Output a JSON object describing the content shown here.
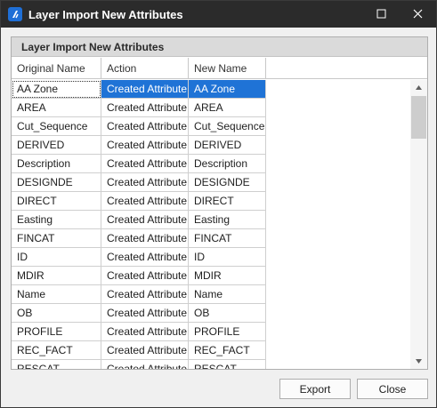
{
  "window": {
    "title": "Layer Import New Attributes",
    "icons": {
      "app": "app-logo-icon",
      "maximize": "maximize-icon",
      "close": "close-icon"
    }
  },
  "panel": {
    "title": "Layer Import New Attributes"
  },
  "grid": {
    "columns": [
      "Original Name",
      "Action",
      "New Name"
    ],
    "rows": [
      {
        "original": "AA Zone",
        "action": "Created Attribute",
        "new_name": "AA Zone"
      },
      {
        "original": "AREA",
        "action": "Created Attribute",
        "new_name": "AREA"
      },
      {
        "original": "Cut_Sequence",
        "action": "Created Attribute",
        "new_name": "Cut_Sequence"
      },
      {
        "original": "DERIVED",
        "action": "Created Attribute",
        "new_name": "DERIVED"
      },
      {
        "original": "Description",
        "action": "Created Attribute",
        "new_name": "Description"
      },
      {
        "original": "DESIGNDE",
        "action": "Created Attribute",
        "new_name": "DESIGNDE"
      },
      {
        "original": "DIRECT",
        "action": "Created Attribute",
        "new_name": "DIRECT"
      },
      {
        "original": "Easting",
        "action": "Created Attribute",
        "new_name": "Easting"
      },
      {
        "original": "FINCAT",
        "action": "Created Attribute",
        "new_name": "FINCAT"
      },
      {
        "original": "ID",
        "action": "Created Attribute",
        "new_name": "ID"
      },
      {
        "original": "MDIR",
        "action": "Created Attribute",
        "new_name": "MDIR"
      },
      {
        "original": "Name",
        "action": "Created Attribute",
        "new_name": "Name"
      },
      {
        "original": "OB",
        "action": "Created Attribute",
        "new_name": "OB"
      },
      {
        "original": "PROFILE",
        "action": "Created Attribute",
        "new_name": "PROFILE"
      },
      {
        "original": "REC_FACT",
        "action": "Created Attribute",
        "new_name": "REC_FACT"
      },
      {
        "original": "RESCAT",
        "action": "Created Attribute",
        "new_name": "RESCAT"
      }
    ],
    "selected_row": 0,
    "selection_color": "#1f73d6"
  },
  "buttons": {
    "export": "Export",
    "close": "Close"
  },
  "colors": {
    "titlebar": "#2b2b2b",
    "accent": "#1f73d6"
  }
}
